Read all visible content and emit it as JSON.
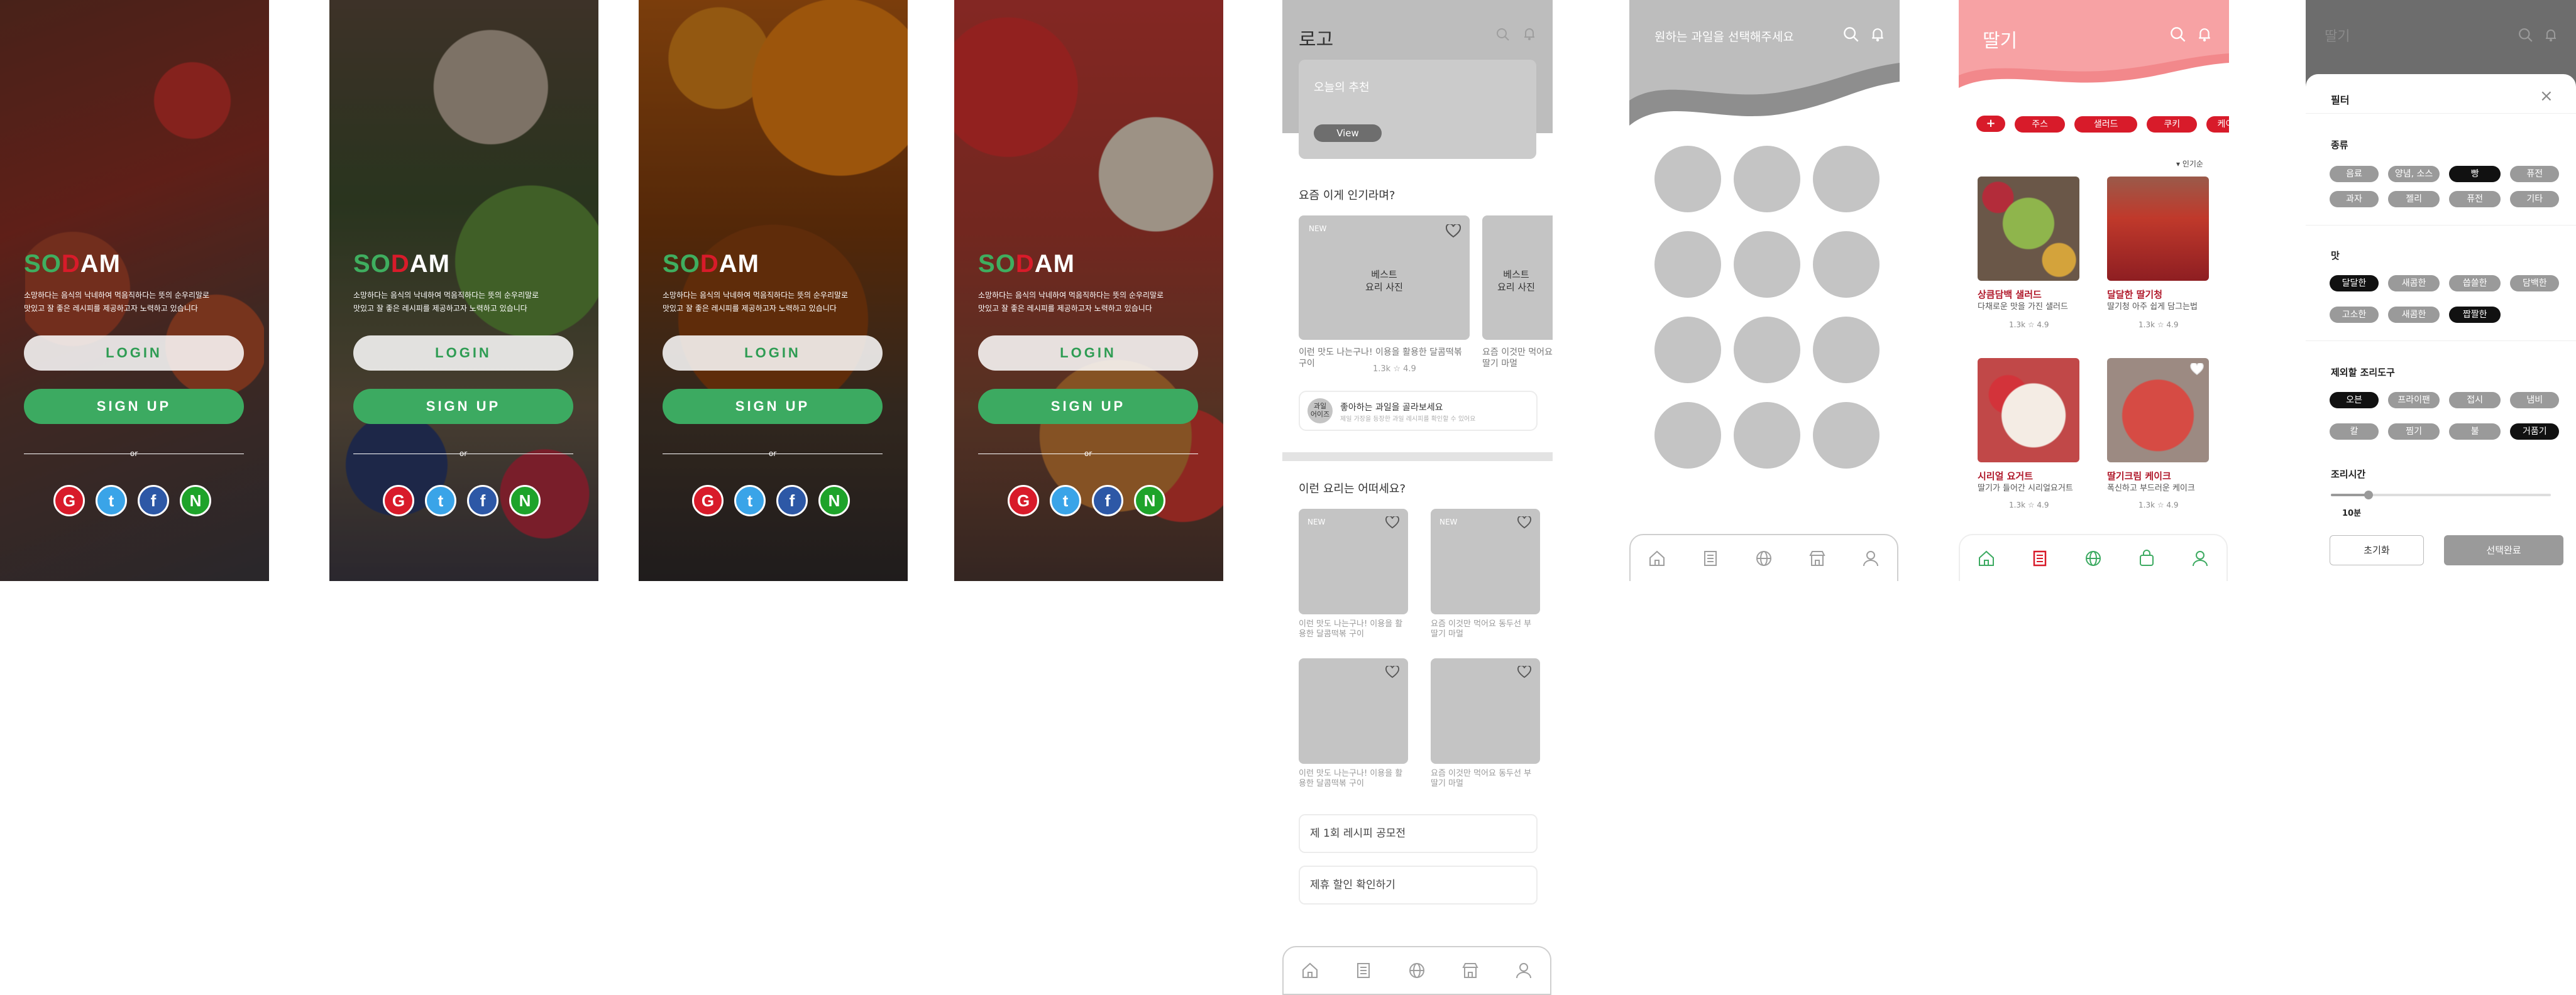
{
  "login": {
    "brand": [
      "S",
      "O",
      "D",
      "AM"
    ],
    "tagline_1": "소망하다는 음식의 낙네하여 먹음직하다는 뜻의 순우리말로",
    "tagline_2": "맛있고 잘 좋은 레시피를 제공하고자 노력하고 있습니다",
    "login_label": "LOGIN",
    "signup_label": "SIGN UP",
    "or_label": "or",
    "social": [
      "G",
      "t",
      "f",
      "N"
    ]
  },
  "home": {
    "logo": "로고",
    "banner_title": "오늘의 추천",
    "banner_button": "View",
    "popular_heading": "요즘 이게 인기라며?",
    "cards": [
      {
        "badge": "NEW",
        "photo_label_1": "베스트",
        "photo_label_2": "요리 사진",
        "caption": "이런 맛도 나는구나! 이용을 활용한 달콤떡볶 ",
        "caption_2": "구이",
        "stats": "1.3k  ☆ 4.9"
      },
      {
        "badge": "",
        "photo_label_1": "베스트",
        "photo_label_2": "요리 사진",
        "caption": "요즘 이것만 먹어요",
        "caption_2": "딸기 마멀",
        "stats": ""
      }
    ],
    "fruit_pick_badge": "과일\n어이즈",
    "fruit_pick_title": "좋아하는 과일을 골라보세요",
    "fruit_pick_sub": "제일 가장을 등장한 과일 레시피를 확인할 수 있어요",
    "section2_heading": "이런 요리는 어떠세요?",
    "grid": [
      {
        "badge": "NEW",
        "caption": "이런 맛도 나는구나! 이용을 활",
        "caption_2": "용한 달콤떡볶 구이"
      },
      {
        "badge": "NEW",
        "caption": "요즘 이것만 먹어요 동두선 부",
        "caption_2": "딸기 마멀"
      },
      {
        "badge": "",
        "caption": "이런 맛도 나는구나! 이용을 활",
        "caption_2": "용한 달콤떡볶 구이"
      },
      {
        "badge": "",
        "caption": "요즘 이것만 먹어요 동두선 부",
        "caption_2": "딸기 마멀"
      }
    ],
    "links": [
      "제 1회 레시피 공모전",
      "제휴 할인 확인하기"
    ]
  },
  "fruit_select": {
    "title": "원하는 과일을 선택해주세요"
  },
  "strawberry": {
    "title": "딸기",
    "chips": [
      "+",
      "주스",
      "샐러드",
      "쿠키",
      "케이"
    ],
    "sort_label": "▾ 인기순",
    "items": [
      {
        "title": "상큼담백 샐러드",
        "sub": "다채로운 맛을 가진 샐러드",
        "stats": "1.3k  ☆ 4.9"
      },
      {
        "title": "달달한 딸기청",
        "sub": "딸기청 아주 쉽게 담그는법",
        "stats": "1.3k  ☆ 4.9"
      },
      {
        "title": "시리얼 요거트",
        "sub": "딸기가 들어간 시리얼요거트",
        "stats": "1.3k  ☆ 4.9"
      },
      {
        "title": "딸기크림 케이크",
        "sub": "폭신하고 부드러운 케이크",
        "stats": "1.3k  ☆ 4.9"
      }
    ]
  },
  "filter": {
    "header_title": "딸기",
    "title": "필터",
    "sections": [
      {
        "label": "종류",
        "chips": [
          [
            "음료",
            "양념, 소스",
            "빵",
            "퓨전"
          ],
          [
            "과자",
            "젤리",
            "퓨전",
            "기타"
          ]
        ],
        "selected": [
          "빵"
        ]
      },
      {
        "label": "맛",
        "chips": [
          [
            "달달한",
            "새콤한",
            "씁쓸한",
            "담백한"
          ],
          [
            "고소한",
            "새콤한",
            "짭짤한"
          ]
        ],
        "selected": [
          "달달한",
          "짭짤한"
        ]
      },
      {
        "label": "제외할 조리도구",
        "chips": [
          [
            "오븐",
            "프라이팬",
            "접시",
            "냄비"
          ],
          [
            "칼",
            "찜기",
            "불",
            "거품기"
          ]
        ],
        "selected": [
          "오븐",
          "거품기"
        ]
      }
    ],
    "time_label": "조리시간",
    "time_value": "10분",
    "time_fraction": 0.17,
    "reset_label": "초기화",
    "apply_label": "선택완료"
  },
  "colors": {
    "green": "#3caa61",
    "red": "#d81b2a",
    "pink": "#f7a2a4",
    "gray": "#bdbdbd"
  }
}
